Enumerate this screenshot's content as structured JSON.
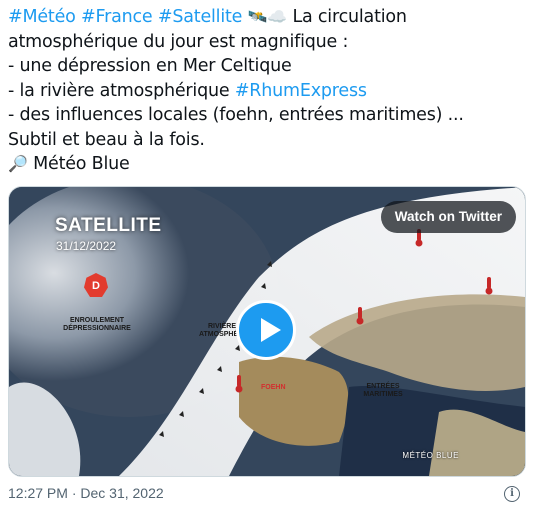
{
  "tweet": {
    "line1": {
      "tag1": "#Météo",
      "tag2": "#France",
      "tag3": "#Satellite",
      "emoji": "🛰️☁️",
      "text": "La circulation"
    },
    "line2": "atmosphérique du jour est magnifique :",
    "line3": "- une dépression en Mer Celtique",
    "line4_prefix": "- la rivière atmosphérique ",
    "line4_tag": "#RhumExpress",
    "line5": "- des influences locales (foehn, entrées maritimes) ...",
    "line6": "Subtil et beau à la fois.",
    "line7_icon": "🔎",
    "line7": "Météo Blue"
  },
  "media": {
    "watch_label": "Watch on Twitter",
    "satellite_title": "SATELLITE",
    "satellite_date": "31/12/2022",
    "depression_marker": "D",
    "label_enroulement": "ENROULEMENT DÉPRESSIONNAIRE",
    "label_riviere": "RIVIÈRE ATMOSPHÉRIQUE",
    "label_foehn": "FOEHN",
    "label_entrees": "ENTRÉES MARITIMES",
    "logo_text": "MÉTÉO BLUE",
    "colors": {
      "thermometer": "#c62828",
      "foehn": "#d32f2f",
      "play": "#1d9bf0"
    }
  },
  "footer": {
    "timestamp": "12:27 PM · Dec 31, 2022",
    "info_icon": "info-icon"
  }
}
